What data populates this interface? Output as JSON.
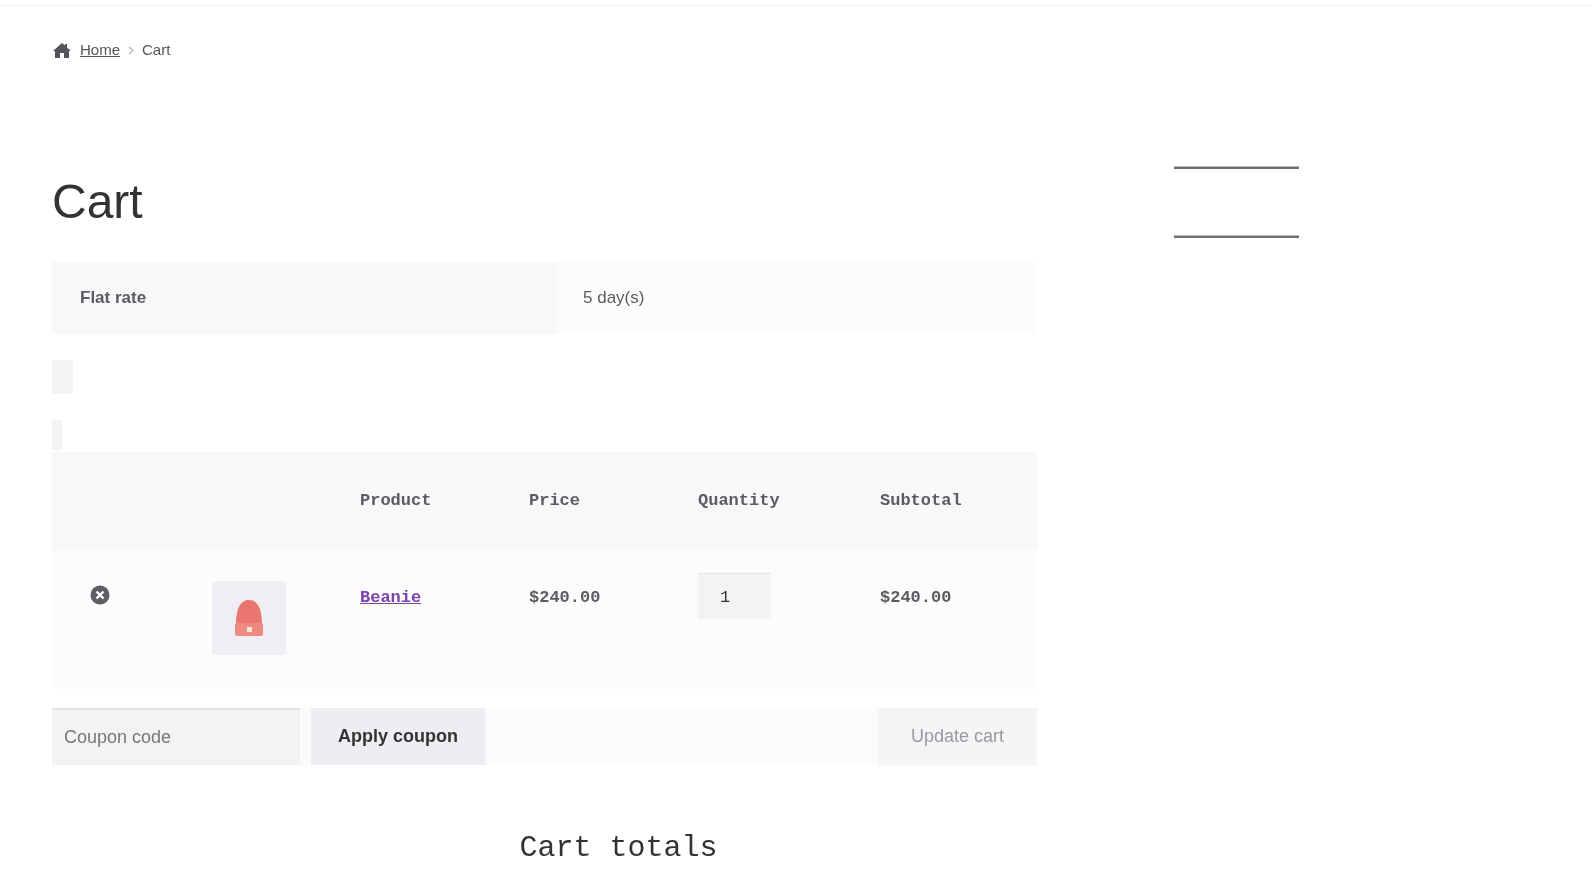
{
  "breadcrumb": [
    {
      "label": "Home",
      "kind": "link"
    },
    {
      "label": "Cart",
      "kind": "current"
    }
  ],
  "title": "Cart",
  "shipping": {
    "label": "Flat rate",
    "value": "5 day(s)"
  },
  "table": {
    "columns": [
      "Product",
      "Price",
      "Quantity",
      "Subtotal"
    ],
    "rows": [
      {
        "product": "Beanie",
        "price": "$240.00",
        "quantity": "1",
        "subtotal": "$240.00"
      }
    ]
  },
  "coupon": {
    "placeholder": "Coupon code",
    "apply": "Apply coupon",
    "update": "Update cart",
    "update_disabled": true
  },
  "totals_title": "Cart totals"
}
